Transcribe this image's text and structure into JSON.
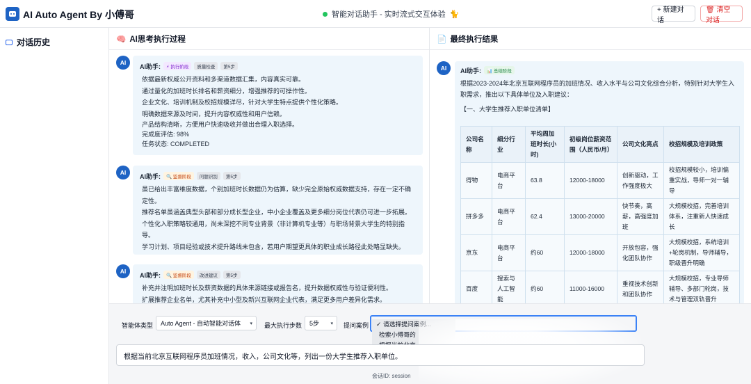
{
  "header": {
    "app_title": "AI Auto Agent By 小傅哥",
    "status_text": "智能对话助手 - 实时流式交互体验",
    "status_emoji": "🐈",
    "new_chat_label": "+ 新建对话",
    "clear_chat_label": "🗑 清空对话"
  },
  "sidebar": {
    "title": "对话历史"
  },
  "panels": {
    "thinking_title": "AI思考执行过程",
    "thinking_icon": "🧠",
    "result_title": "最终执行结果",
    "result_icon": "📄"
  },
  "thinking": {
    "messages": [
      {
        "avatar": "AI",
        "speaker": "AI助手:",
        "stage": "⚡ 执行阶段",
        "tag": "质量检查",
        "step": "第5步",
        "lines": [
          "依据最新权威公开资料和多渠道数据汇集，内容真实可靠。",
          "通过量化的加班时长排名和薪资细分，增强推荐的可操作性。",
          "企业文化、培训机制及校招规模详尽，针对大学生特点提供个性化策略。",
          "明确数据来源及时间，提升内容权威性和用户信赖。",
          "产品结构清晰，方便用户快速吸收并做出合理入职选择。",
          "完成度评估: 98%",
          "任务状态: COMPLETED"
        ]
      },
      {
        "avatar": "AI",
        "speaker": "AI助手:",
        "stage": "🔍 监督阶段",
        "tag": "问题识别",
        "step": "第5步",
        "lines": [
          "虽已给出丰富维度数据，个别加班时长数据仍为估算，缺少完全原始权威数据支持，存在一定不确定性。",
          "推荐名单虽涵盖典型头部和部分成长型企业，中小企业覆盖及更多细分岗位代表仍可进一步拓展。",
          "个性化入职策略较通用，尚未深挖不同专业背景（非计算机专业等）与职场背景大学生的特别指导。",
          "学习计划、项目经验或技术提升路线未包含，若用户期望更具体的职业成长路径此处略显缺失。"
        ]
      },
      {
        "avatar": "AI",
        "speaker": "AI助手:",
        "stage": "🔍 监督阶段",
        "tag": "改进建议",
        "step": "第5步",
        "lines": [
          "补充并注明加班时长及薪资数据的具体来源链接或报告名，提升数据权威性与验证便利性。",
          "扩展推荐企业名单，尤其补充中小型及新兴互联网企业代表，满足更多用户差异化需求。"
        ]
      }
    ]
  },
  "result": {
    "avatar": "AI",
    "speaker": "AI助手:",
    "stage": "📊 总结阶段",
    "intro": "根据2023-2024年北京互联网程序员的加班情况、收入水平与公司文化综合分析，特别针对大学生入职需求，推出以下具体单位及入职建议：",
    "section": "【一、大学生推荐入职单位清单】",
    "table": {
      "headers": [
        "公司名称",
        "细分行业",
        "平均周加班时长(小时)",
        "初级岗位薪资范围（人民币/月）",
        "公司文化亮点",
        "校招规模及培训政策"
      ],
      "rows": [
        [
          "得物",
          "电商平台",
          "63.8",
          "12000-18000",
          "创新驱动，工作强度极大",
          "校招规模较小，培训偏重实战，导师一对一辅导"
        ],
        [
          "拼多多",
          "电商平台",
          "62.4",
          "13000-20000",
          "快节奏，高薪，高强度加班",
          "大规模校招，完善培训体系，注重新人快速成长"
        ],
        [
          "京东",
          "电商平台",
          "约60",
          "12000-18000",
          "开放包容，强化团队协作",
          "大规模校招，系统培训+轮岗机制，导师辅导，职级晋升明确"
        ],
        [
          "百度",
          "搜索与人工智能",
          "约60",
          "11000-16000",
          "重视技术创新和团队协作",
          "大规模校招，专业导师辅导、多部门轮岗，技术与管理双轨晋升"
        ]
      ]
    }
  },
  "controls": {
    "agent_type_label": "智能体类型",
    "agent_type_value": "Auto Agent - 自动智能对话体",
    "max_steps_label": "最大执行步数",
    "max_steps_value": "5步",
    "case_label": "提问案例",
    "case_options": [
      "✓ 请选择提问案例...",
      "检索小傅哥的",
      "根据当前北京"
    ],
    "prompt_value": "根据当前北京互联网程序员加班情况，收入，公司文化等，列出一份大学生推荐入职单位。",
    "session_text": "会话ID: session"
  },
  "colors": {
    "brand": "#1e63c4",
    "accent": "#3b82f6",
    "danger": "#dc2626",
    "status": "#22c55e",
    "bubble": "#eef6fc"
  }
}
